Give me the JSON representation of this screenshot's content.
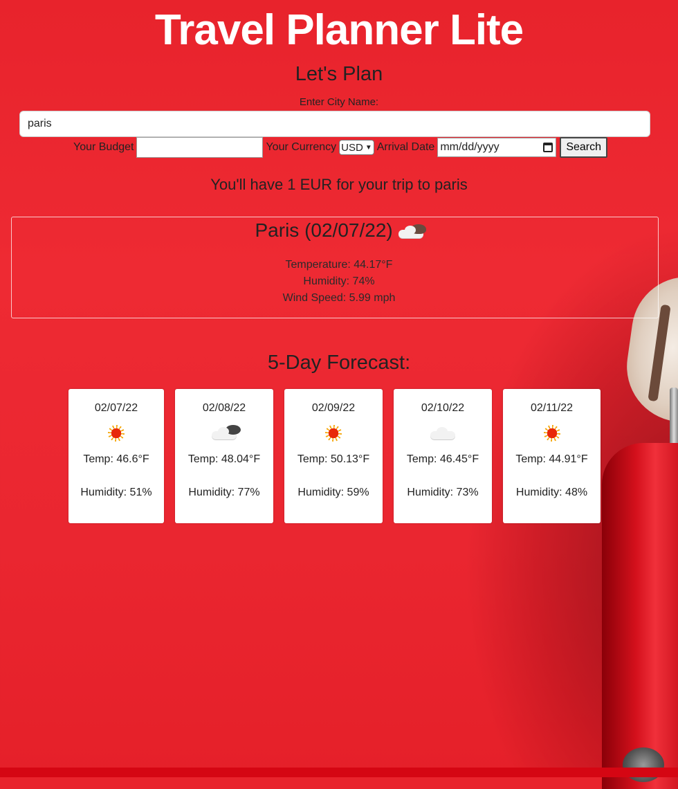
{
  "header": {
    "title": "Travel Planner Lite",
    "subtitle": "Let's Plan"
  },
  "form": {
    "city_label": "Enter City Name:",
    "city_value": "paris",
    "budget_label": "Your Budget",
    "budget_value": "",
    "currency_label": "Your Currency",
    "currency_selected": "USD",
    "arrival_label": "Arrival Date",
    "arrival_placeholder": "mm/dd/yyyy",
    "search_label": "Search"
  },
  "budget_message": "You'll have 1 EUR for your trip to paris",
  "current": {
    "title": "Paris (02/07/22)",
    "icon": "partly-cloudy-icon",
    "temperature": "Temperature: 44.17°F",
    "humidity": "Humidity: 74%",
    "wind": "Wind Speed: 5.99 mph"
  },
  "forecast": {
    "title": "5-Day Forecast:",
    "days": [
      {
        "date": "02/07/22",
        "icon": "sun-icon",
        "temp": "Temp: 46.6°F",
        "humidity": "Humidity: 51%"
      },
      {
        "date": "02/08/22",
        "icon": "cloud-icon",
        "temp": "Temp: 48.04°F",
        "humidity": "Humidity: 77%"
      },
      {
        "date": "02/09/22",
        "icon": "sun-icon",
        "temp": "Temp: 50.13°F",
        "humidity": "Humidity: 59%"
      },
      {
        "date": "02/10/22",
        "icon": "cloud-icon",
        "temp": "Temp: 46.45°F",
        "humidity": "Humidity: 73%"
      },
      {
        "date": "02/11/22",
        "icon": "sun-icon",
        "temp": "Temp: 44.91°F",
        "humidity": "Humidity: 48%"
      }
    ]
  },
  "colors": {
    "background": "#ea2630",
    "accent_bar": "#d50613",
    "title": "#ffffff"
  }
}
